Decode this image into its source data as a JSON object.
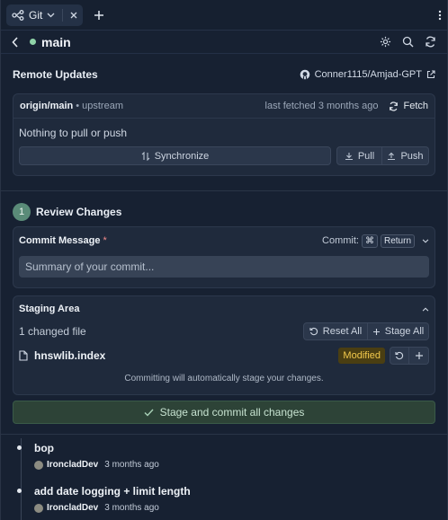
{
  "tabs": {
    "git_label": "Git"
  },
  "header": {
    "branch": "main"
  },
  "remote": {
    "title": "Remote Updates",
    "repo": "Conner1115/Amjad-GPT",
    "branch": "origin/main",
    "upstream": "upstream",
    "last_fetched": "last fetched 3 months ago",
    "fetch_label": "Fetch",
    "status": "Nothing to pull or push",
    "sync_label": "Synchronize",
    "pull_label": "Pull",
    "push_label": "Push"
  },
  "review": {
    "step": "1",
    "title": "Review Changes",
    "commit_message_label": "Commit Message",
    "required_mark": "*",
    "commit_label": "Commit:",
    "kbd_cmd": "⌘",
    "kbd_return": "Return",
    "placeholder": "Summary of your commit...",
    "staging_title": "Staging Area",
    "changed_count": "1 changed file",
    "reset_all": "Reset All",
    "stage_all": "Stage All",
    "file_name": "hnswlib.index",
    "file_status": "Modified",
    "auto_stage_note": "Committing will automatically stage your changes.",
    "commit_button": "Stage and commit all changes"
  },
  "history": [
    {
      "title": "bop",
      "author": "IroncladDev",
      "time": "3 months ago"
    },
    {
      "title": "add date logging + limit length",
      "author": "IroncladDev",
      "time": "3 months ago"
    }
  ],
  "colors": {
    "accent_green": "#5a8b78",
    "modified_badge": "#f2c94c",
    "branch_dot": "#8fd3a8"
  }
}
